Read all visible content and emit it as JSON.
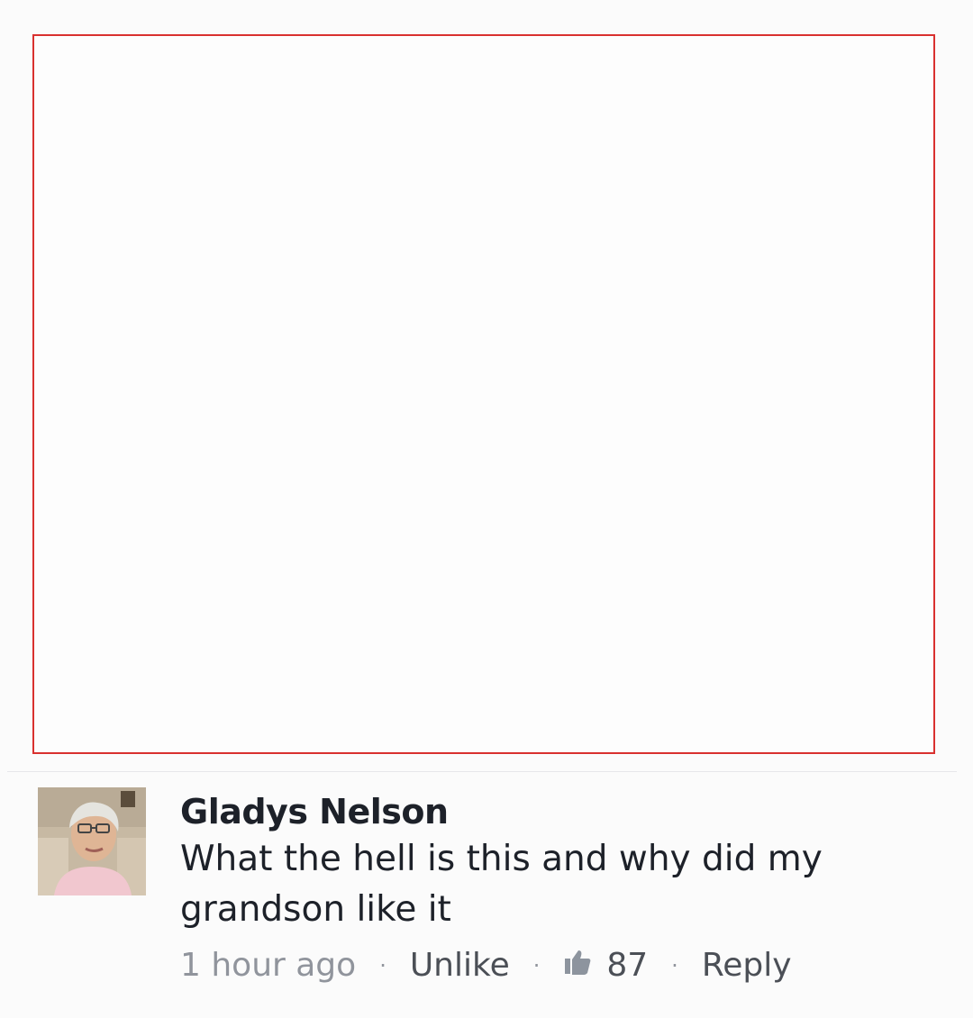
{
  "post": {
    "image_border_color": "#d9312f"
  },
  "comment": {
    "author": "Gladys Nelson",
    "text": "What the hell is this and why did my grandson like it",
    "time": "1 hour ago",
    "unlike_label": "Unlike",
    "like_icon": "thumbs-up-icon",
    "like_count": "87",
    "reply_label": "Reply",
    "separator": "·"
  },
  "colors": {
    "name_text": "#1d2129",
    "meta_text": "#90949c",
    "action_text": "#4b4f56"
  }
}
